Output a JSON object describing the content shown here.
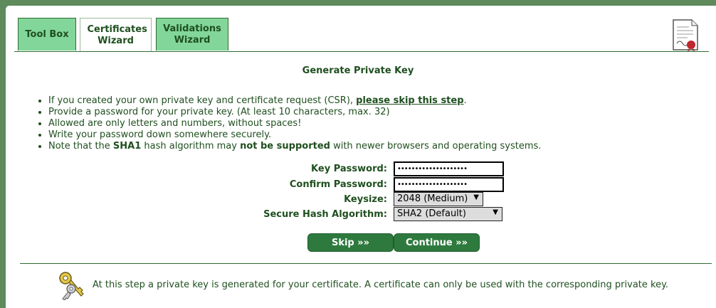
{
  "tabs": [
    {
      "label": "Tool Box"
    },
    {
      "label": "Certificates Wizard"
    },
    {
      "label": "Validations Wizard"
    }
  ],
  "heading": "Generate Private Key",
  "notes": {
    "line1_pre": "If you created your own private key and certificate request (CSR), ",
    "line1_link": "please skip this step",
    "line1_post": ".",
    "line2": "Provide a password for your private key. (At least 10 characters, max. 32)",
    "line3": "Allowed are only letters and numbers, without spaces!",
    "line4": "Write your password down somewhere securely.",
    "line5_a": "Note that the ",
    "line5_b": "SHA1",
    "line5_c": " hash algorithm may ",
    "line5_d": "not be supported",
    "line5_e": " with newer browsers and operating systems."
  },
  "form": {
    "key_password_label": "Key Password:",
    "key_password_value": "••••••••••••••••••••",
    "confirm_password_label": "Confirm Password:",
    "confirm_password_value": "••••••••••••••••••••",
    "keysize_label": "Keysize:",
    "keysize_value": "2048 (Medium)",
    "hash_label": "Secure Hash Algorithm:",
    "hash_value": "SHA2 (Default)"
  },
  "buttons": {
    "skip": "Skip »»",
    "continue": "Continue »»"
  },
  "info_text": "At this step a private key is generated for your certificate. A certificate can only be used with the corresponding private key.",
  "icons": {
    "certificate": "certificate-document-icon",
    "keys": "keys-icon"
  },
  "colors": {
    "accent": "#2e7a3e",
    "tab_bg": "#82d69a",
    "text": "#1f4f1f"
  }
}
